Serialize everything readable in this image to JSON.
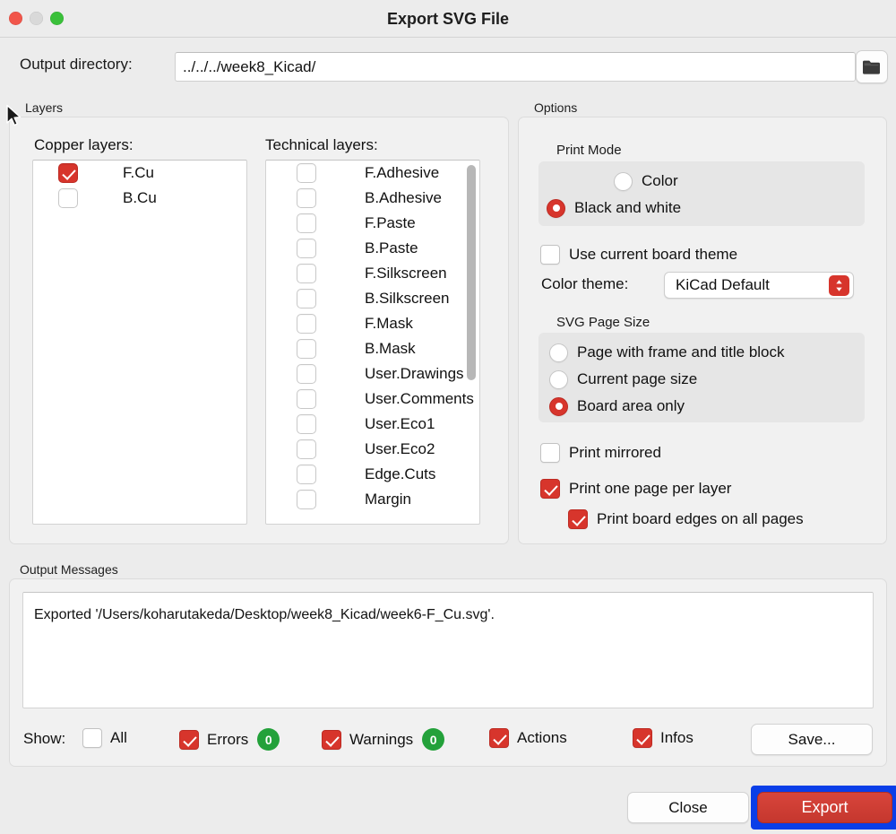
{
  "window": {
    "title": "Export SVG File",
    "traffic_lights": [
      "close-red",
      "minimize-gray",
      "zoom-green"
    ]
  },
  "output_directory": {
    "label": "Output directory:",
    "value": "../../../week8_Kicad/",
    "placeholder": "",
    "browse_icon": "folder-icon"
  },
  "layers": {
    "group_title": "Layers",
    "copper": {
      "label": "Copper layers:",
      "items": [
        {
          "label": "F.Cu",
          "checked": true
        },
        {
          "label": "B.Cu",
          "checked": false
        }
      ]
    },
    "technical": {
      "label": "Technical layers:",
      "items": [
        {
          "label": "F.Adhesive",
          "checked": false
        },
        {
          "label": "B.Adhesive",
          "checked": false
        },
        {
          "label": "F.Paste",
          "checked": false
        },
        {
          "label": "B.Paste",
          "checked": false
        },
        {
          "label": "F.Silkscreen",
          "checked": false
        },
        {
          "label": "B.Silkscreen",
          "checked": false
        },
        {
          "label": "F.Mask",
          "checked": false
        },
        {
          "label": "B.Mask",
          "checked": false
        },
        {
          "label": "User.Drawings",
          "checked": false
        },
        {
          "label": "User.Comments",
          "checked": false
        },
        {
          "label": "User.Eco1",
          "checked": false
        },
        {
          "label": "User.Eco2",
          "checked": false
        },
        {
          "label": "Edge.Cuts",
          "checked": false
        },
        {
          "label": "Margin",
          "checked": false
        }
      ]
    }
  },
  "options": {
    "group_title": "Options",
    "print_mode": {
      "title": "Print Mode",
      "options": [
        {
          "label": "Color",
          "selected": false
        },
        {
          "label": "Black and white",
          "selected": true
        }
      ]
    },
    "use_board_theme": {
      "label": "Use current board theme",
      "checked": false
    },
    "color_theme": {
      "label": "Color theme:",
      "value": "KiCad Default",
      "stepper_icon": "chevron-updown-icon"
    },
    "svg_page_size": {
      "title": "SVG Page Size",
      "options": [
        {
          "label": "Page with frame and title block",
          "selected": false
        },
        {
          "label": "Current page size",
          "selected": false
        },
        {
          "label": "Board area only",
          "selected": true
        }
      ]
    },
    "print_mirrored": {
      "label": "Print mirrored",
      "checked": false
    },
    "print_one_page_per_layer": {
      "label": "Print one page per layer",
      "checked": true
    },
    "print_board_edges": {
      "label": "Print board edges on all pages",
      "checked": true
    }
  },
  "output_messages": {
    "group_title": "Output Messages",
    "text": "Exported '/Users/koharutakeda/Desktop/week8_Kicad/week6-F_Cu.svg'."
  },
  "show_bar": {
    "label": "Show:",
    "filters": [
      {
        "label": "All",
        "checked": false,
        "badge": null
      },
      {
        "label": "Errors",
        "checked": true,
        "badge": "0"
      },
      {
        "label": "Warnings",
        "checked": true,
        "badge": "0"
      },
      {
        "label": "Actions",
        "checked": true,
        "badge": null
      },
      {
        "label": "Infos",
        "checked": true,
        "badge": null
      }
    ],
    "save_label": "Save..."
  },
  "footer": {
    "close_label": "Close",
    "export_label": "Export"
  },
  "colors": {
    "accent_red": "#d7352c",
    "badge_green": "#23a13a",
    "focus_blue": "#0a3ee8",
    "window_bg": "#ececec"
  }
}
